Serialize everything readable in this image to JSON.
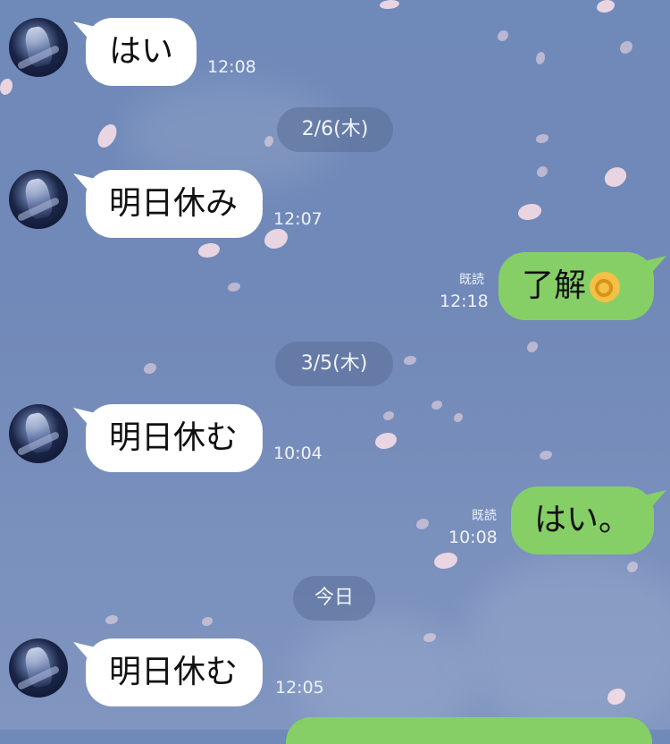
{
  "messages": [
    {
      "side": "in",
      "text": "はい",
      "time": "12:08"
    },
    {
      "date": "2/6(木)"
    },
    {
      "side": "in",
      "text": "明日休み",
      "time": "12:07"
    },
    {
      "side": "out",
      "text": "了解",
      "time": "12:18",
      "read": "既読",
      "emoji": "ok-hand-emoji"
    },
    {
      "date": "3/5(木)"
    },
    {
      "side": "in",
      "text": "明日休む",
      "time": "10:04"
    },
    {
      "side": "out",
      "text": "はい。",
      "time": "10:08",
      "read": "既読"
    },
    {
      "date": "今日"
    },
    {
      "side": "in",
      "text": "明日休む",
      "time": "12:05"
    }
  ],
  "colors": {
    "background": "#7189b8",
    "incoming_bubble": "#ffffff",
    "outgoing_bubble": "#86cf67"
  }
}
